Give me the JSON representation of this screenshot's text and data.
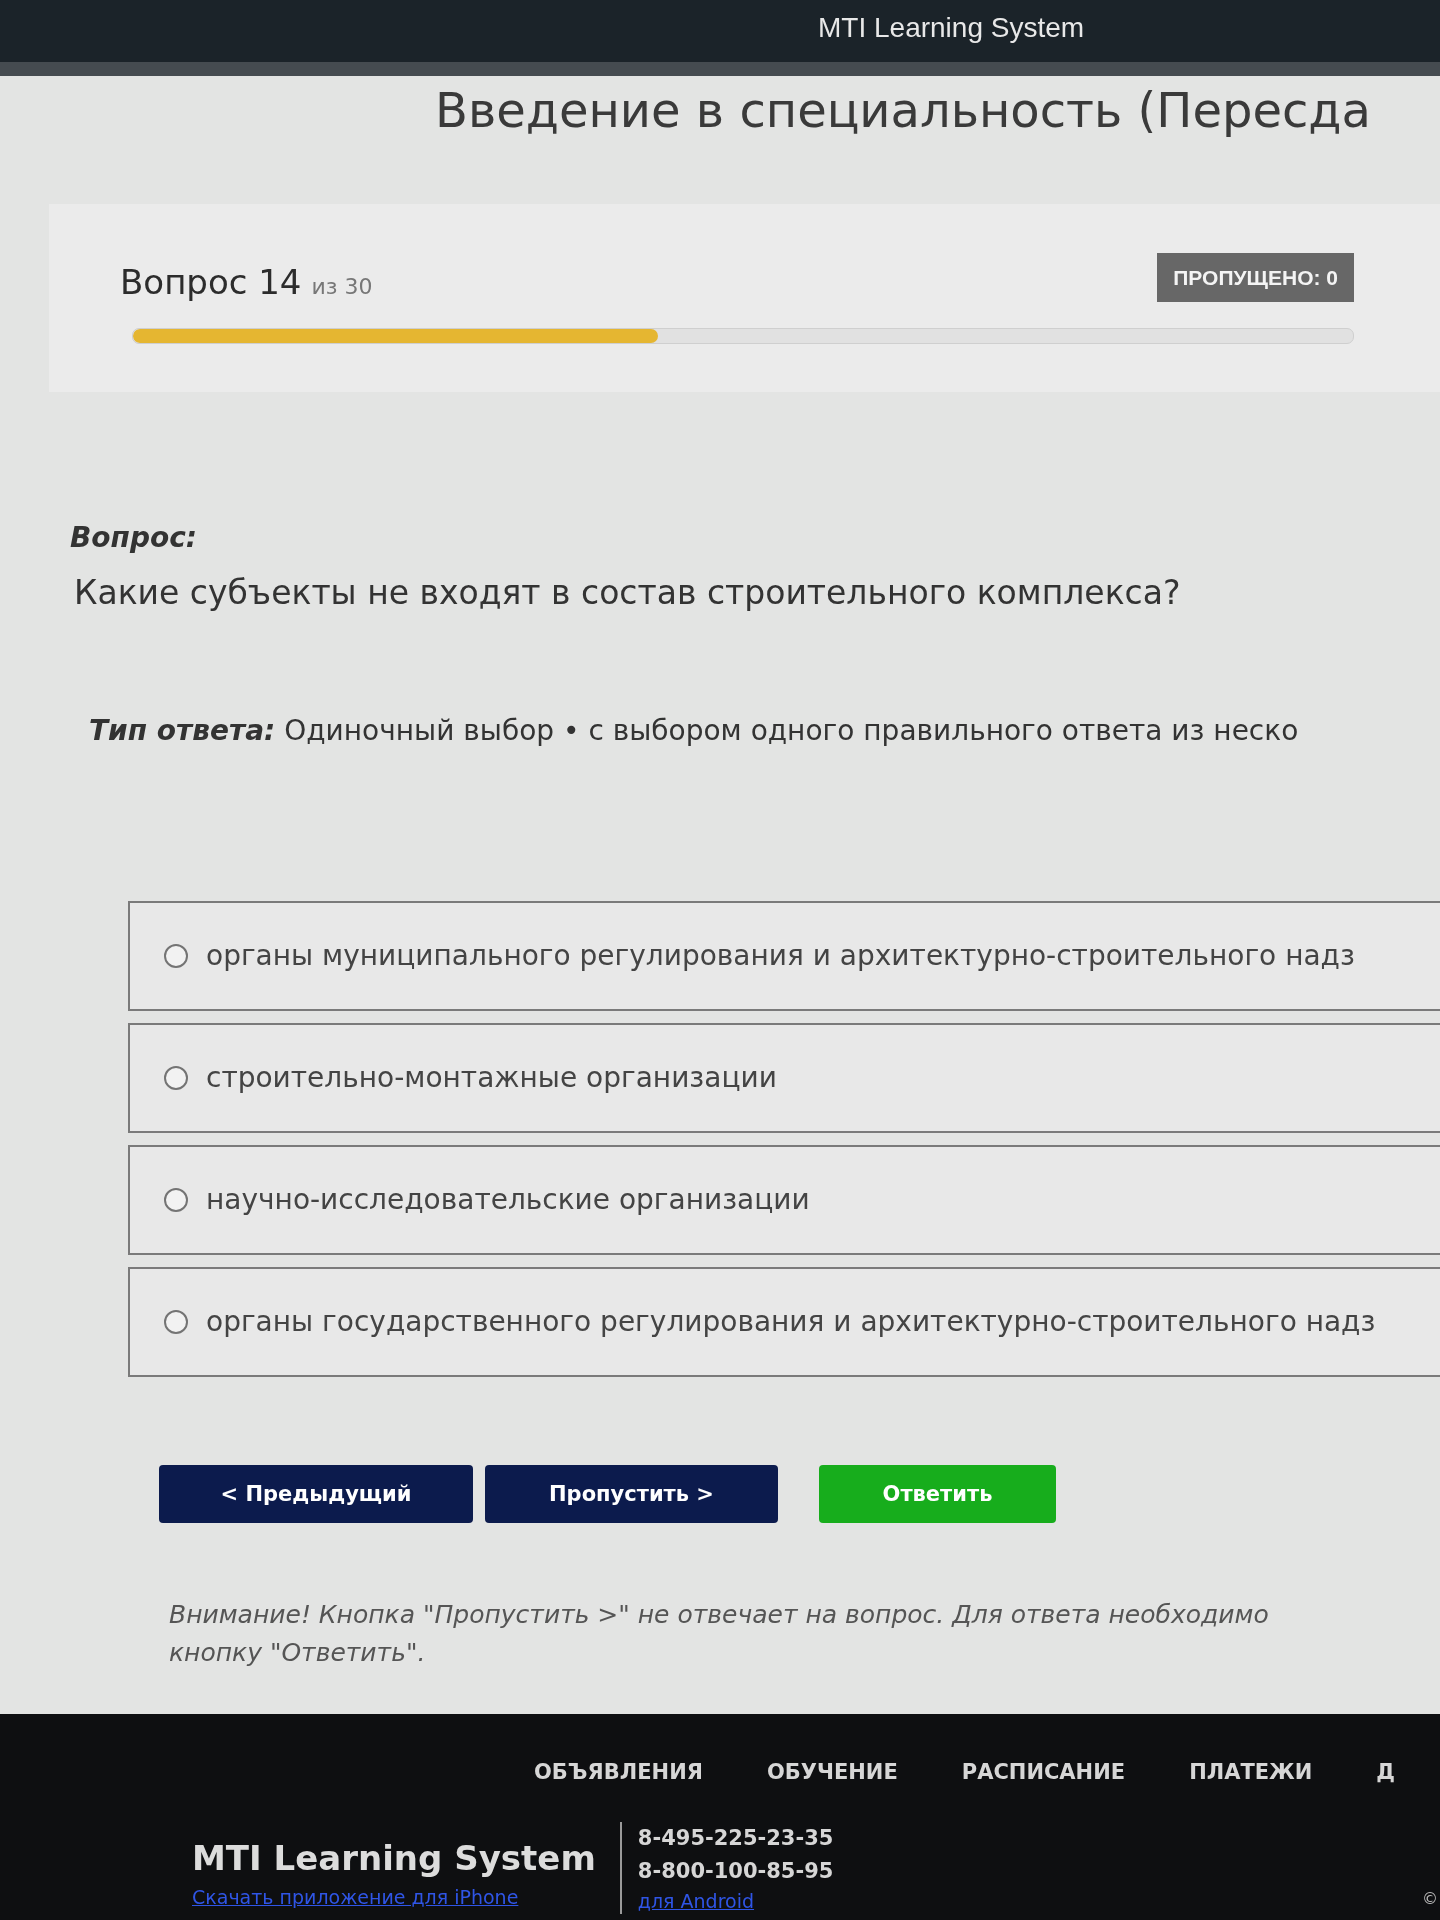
{
  "header": {
    "title": "MTI Learning System"
  },
  "page_title": "Введение в специальность (Пересда",
  "progress": {
    "label": "Вопрос 14",
    "total": "из 30",
    "skipped_badge": "ПРОПУЩЕНО: 0",
    "level": 0.43
  },
  "question": {
    "heading": "Вопрос:",
    "text": "Какие субъекты не входят в состав строительного комплекса?",
    "answer_type": "*Тип ответа:* Одиночный выбор • с выбором одного правильного ответа из неско"
  },
  "options": [
    {
      "label": "органы муниципального регулирования и архитектурно-строительного надз",
      "selected": false
    },
    {
      "label": "строительно-монтажные организации",
      "selected": false
    },
    {
      "label": "научно-исследовательские организации",
      "selected": false
    },
    {
      "label": "органы государственного регулирования и архитектурно-строительного надз",
      "selected": false
    }
  ],
  "buttons": [
    {
      "label": "< Предыдущий",
      "kind": "back"
    },
    {
      "label": "Пропустить >",
      "kind": "skip"
    },
    {
      "label": "Ответить",
      "kind": "submit"
    }
  ],
  "note": "Внимание! Кнопка \"Пропустить >\" не отвечает на вопрос. Для ответа необходимо\nкнопку \"Ответить\".",
  "footer": {
    "nav": [
      "ОБЪЯВЛЕНИЯ",
      "ОБУЧЕНИЕ",
      "РАСПИСАНИЕ",
      "ПЛАТЕЖИ",
      "Д"
    ],
    "brand": "MTI Learning System",
    "ios_link": "Скачать приложение для iPhone",
    "phones": [
      "8-495-225-23-35",
      "8-800-100-85-95"
    ],
    "android_link": "для Android",
    "copyright": "©"
  }
}
